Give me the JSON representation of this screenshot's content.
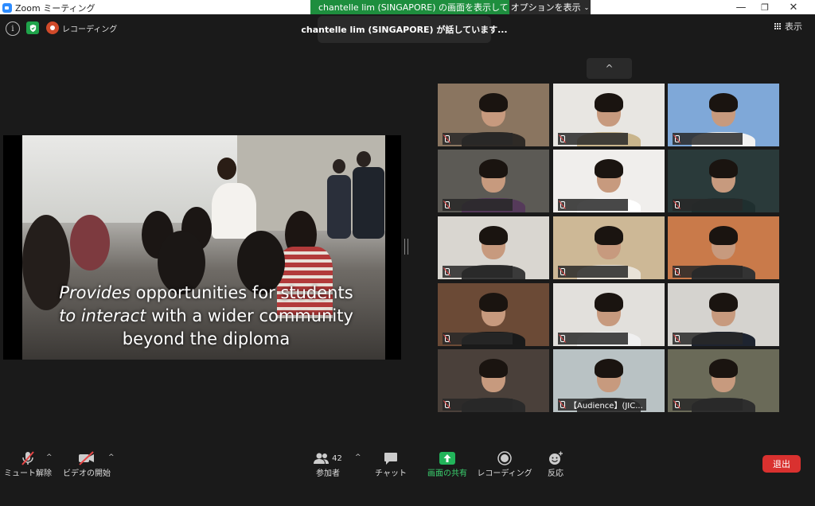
{
  "window": {
    "title": "Zoom ミーティング"
  },
  "share_banner": {
    "text": "chantelle lim (SINGAPORE) の画面を表示しています",
    "options_label": "オプションを表示"
  },
  "window_controls": {
    "minimize": "—",
    "maximize": "❐",
    "close": "✕"
  },
  "topbar": {
    "info_glyph": "i",
    "recording_label": "レコーディング"
  },
  "speaker_popup": {
    "text": "chantelle lim (SINGAPORE) が話しています..."
  },
  "view": {
    "label": "表示"
  },
  "collapse": {
    "glyph": "^"
  },
  "shared_screen": {
    "caption_line1_em": "Provides",
    "caption_line1_rest": " opportunities for students",
    "caption_line2_em": "to interact",
    "caption_line2_rest": " with a wider community",
    "caption_line3": "beyond the diploma"
  },
  "participants": [
    {
      "name": "",
      "muted": true,
      "bg": "#8a7560",
      "shirt": "#2e2a26"
    },
    {
      "name": "",
      "muted": true,
      "bg": "#e8e6e2",
      "shirt": "#c9b58c"
    },
    {
      "name": "",
      "muted": true,
      "bg": "#7fa8d8",
      "shirt": "#f2f2f2"
    },
    {
      "name": "",
      "muted": true,
      "bg": "#5c5a55",
      "shirt": "#553a5a"
    },
    {
      "name": "",
      "muted": true,
      "bg": "#f0eeec",
      "shirt": "#ffffff"
    },
    {
      "name": "",
      "muted": true,
      "bg": "#2a3a3a",
      "shirt": "#1f2f2f"
    },
    {
      "name": "",
      "muted": true,
      "bg": "#d9d6d0",
      "shirt": "#3a3a3a"
    },
    {
      "name": "",
      "muted": true,
      "bg": "#cdb896",
      "shirt": "#e8e2d8"
    },
    {
      "name": "",
      "muted": true,
      "bg": "#c97a4a",
      "shirt": "#333333"
    },
    {
      "name": "",
      "muted": true,
      "bg": "#6b4a36",
      "shirt": "#1a1a1a"
    },
    {
      "name": "",
      "muted": true,
      "bg": "#e2e0dc",
      "shirt": "#f0f0f0"
    },
    {
      "name": "",
      "muted": true,
      "bg": "#d5d3cf",
      "shirt": "#1e2430"
    },
    {
      "name": "",
      "muted": true,
      "bg": "#4a403a",
      "shirt": "#2a2a2a"
    },
    {
      "name": "【Audience】(JIC...",
      "muted": true,
      "bg": "#b9c2c4",
      "shirt": "#3a3a3a"
    },
    {
      "name": "",
      "muted": true,
      "bg": "#6a6a58",
      "shirt": "#2e2e2e"
    }
  ],
  "toolbar": {
    "unmute_label": "ミュート解除",
    "start_video_label": "ビデオの開始",
    "participants_label": "参加者",
    "participants_count": "42",
    "chat_label": "チャット",
    "share_label": "画面の共有",
    "record_label": "レコーディング",
    "reactions_label": "反応",
    "leave_label": "退出"
  },
  "colors": {
    "share_green": "#1e8e3e",
    "leave_red": "#d9312f",
    "mute_red": "#e54545",
    "zoom_blue": "#2d8cff"
  }
}
